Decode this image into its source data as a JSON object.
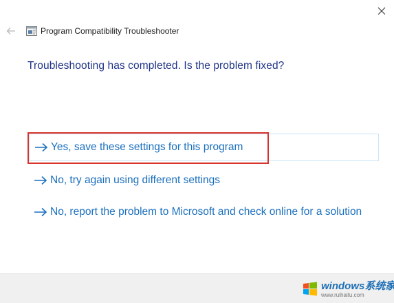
{
  "window": {
    "title": "Program Compatibility Troubleshooter",
    "close_icon": "close-icon",
    "back_icon": "back-arrow-icon",
    "app_icon": "troubleshooter-app-icon"
  },
  "main": {
    "question": "Troubleshooting has completed.  Is the problem fixed?",
    "options": [
      {
        "label": "Yes, save these settings for this program",
        "icon": "arrow-right-icon",
        "hovered": true,
        "highlighted": true
      },
      {
        "label": "No, try again using different settings",
        "icon": "arrow-right-icon",
        "hovered": false,
        "highlighted": false
      },
      {
        "label": "No, report the problem to Microsoft and check online for a solution",
        "icon": "arrow-right-icon",
        "hovered": false,
        "highlighted": false
      }
    ]
  },
  "watermark": {
    "main": "windows系统家园",
    "sub": "www.ruihaitu.com"
  },
  "colors": {
    "link": "#1a6fbe",
    "question": "#1e3287",
    "highlight": "#d9342b",
    "hover_border": "#cce4f7",
    "footer": "#f0f0f0"
  }
}
